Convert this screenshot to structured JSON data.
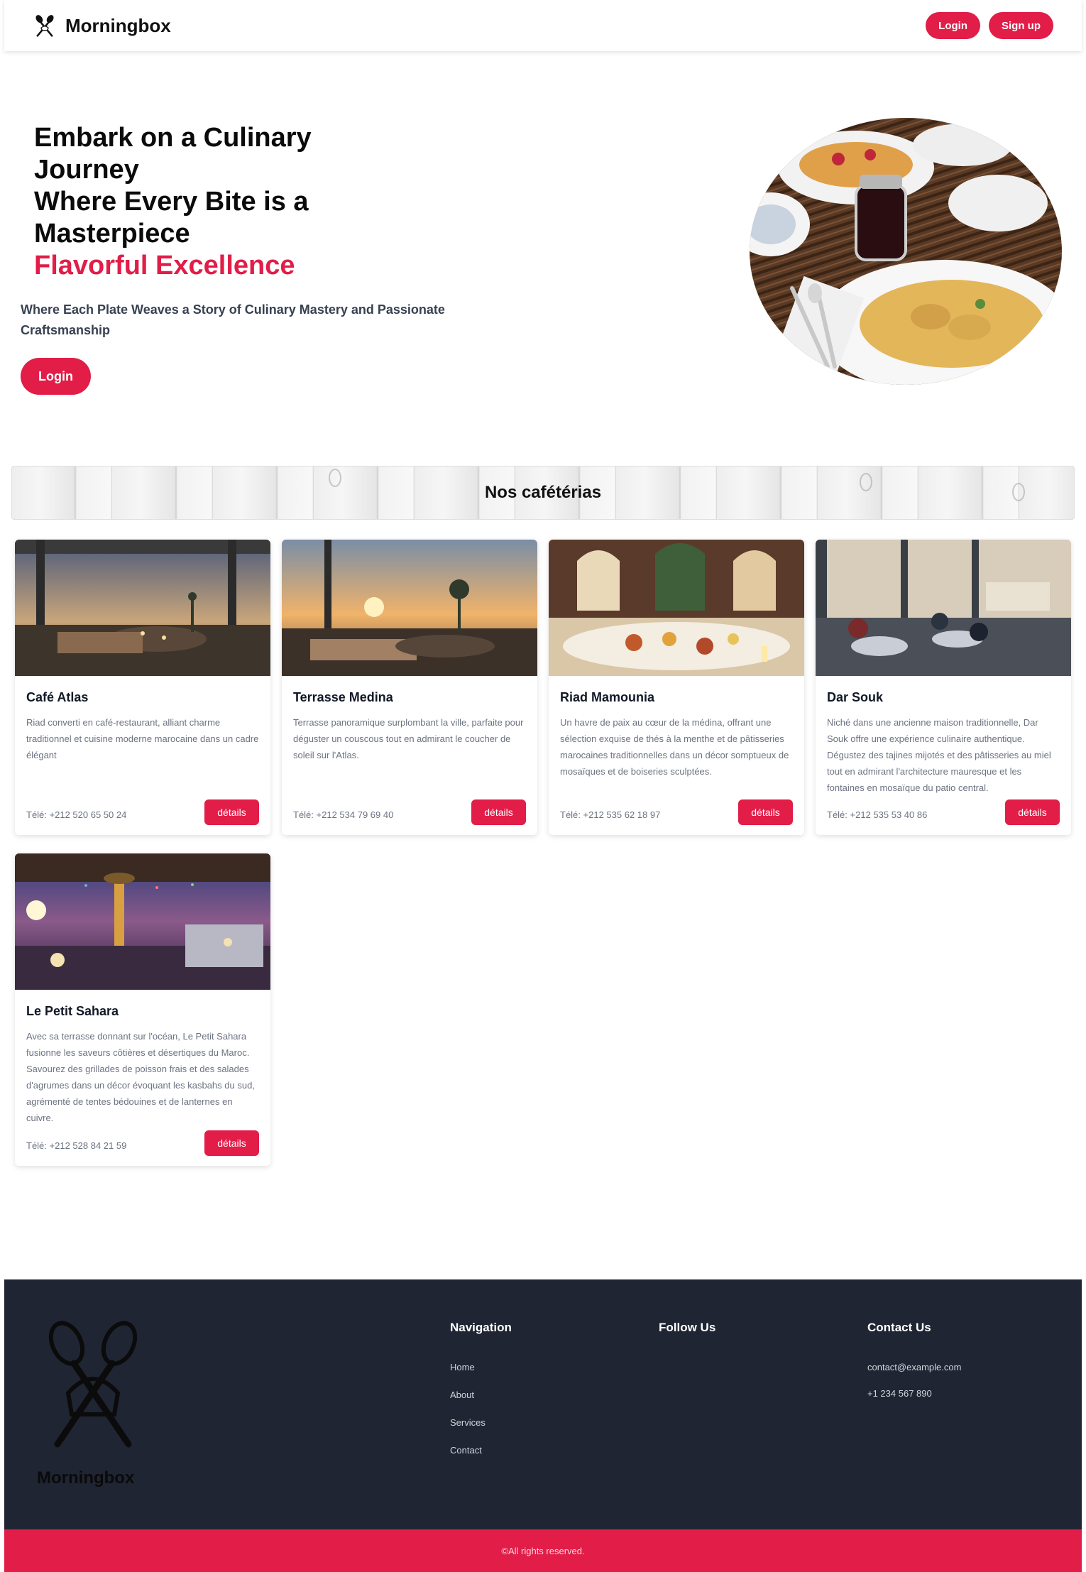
{
  "header": {
    "brand": "Morningbox",
    "login_label": "Login",
    "signup_label": "Sign up"
  },
  "hero": {
    "title_line1": "Embark on a Culinary Journey",
    "title_line2": "Where Every Bite is a Masterpiece",
    "title_accent": "Flavorful Excellence",
    "subtitle": "Where Each Plate Weaves a Story of Culinary Mastery and Passionate Craftsmanship",
    "login_label": "Login"
  },
  "section": {
    "title": "Nos cafétérias"
  },
  "cafes": [
    {
      "name": "Café Atlas",
      "description": "Riad converti en café-restaurant, alliant charme traditionnel et cuisine moderne marocaine dans un cadre élégant",
      "phone": "Télé: +212 520 65 50 24",
      "button": "détails"
    },
    {
      "name": "Terrasse Medina",
      "description": "Terrasse panoramique surplombant la ville, parfaite pour déguster un couscous tout en admirant le coucher de soleil sur l'Atlas.",
      "phone": "Télé: +212 534 79 69 40",
      "button": "détails"
    },
    {
      "name": "Riad Mamounia",
      "description": "Un havre de paix au cœur de la médina, offrant une sélection exquise de thés à la menthe et de pâtisseries marocaines traditionnelles dans un décor somptueux de mosaïques et de boiseries sculptées.",
      "phone": "Télé: +212 535 62 18 97",
      "button": "détails"
    },
    {
      "name": "Dar Souk",
      "description": "Niché dans une ancienne maison traditionnelle, Dar Souk offre une expérience culinaire authentique. Dégustez des tajines mijotés et des pâtisseries au miel tout en admirant l'architecture mauresque et les fontaines en mosaïque du patio central.",
      "phone": "Télé: +212 535 53 40 86",
      "button": "détails"
    },
    {
      "name": "Le Petit Sahara",
      "description": "Avec sa terrasse donnant sur l'océan, Le Petit Sahara fusionne les saveurs côtières et désertiques du Maroc. Savourez des grillades de poisson frais et des salades d'agrumes dans un décor évoquant les kasbahs du sud, agrémenté de tentes bédouines et de lanternes en cuivre.",
      "phone": "Télé: +212 528 84 21 59",
      "button": "détails"
    }
  ],
  "footer": {
    "brand": "Morningbox",
    "navigation": {
      "title": "Navigation",
      "links": [
        "Home",
        "About",
        "Services",
        "Contact"
      ]
    },
    "follow": {
      "title": "Follow Us"
    },
    "contact": {
      "title": "Contact Us",
      "email": "contact@example.com",
      "phone": "+1 234 567 890"
    },
    "copyright": "©All rights reserved."
  },
  "colors": {
    "accent": "#e11d48",
    "footer_bg": "#1f2533"
  }
}
